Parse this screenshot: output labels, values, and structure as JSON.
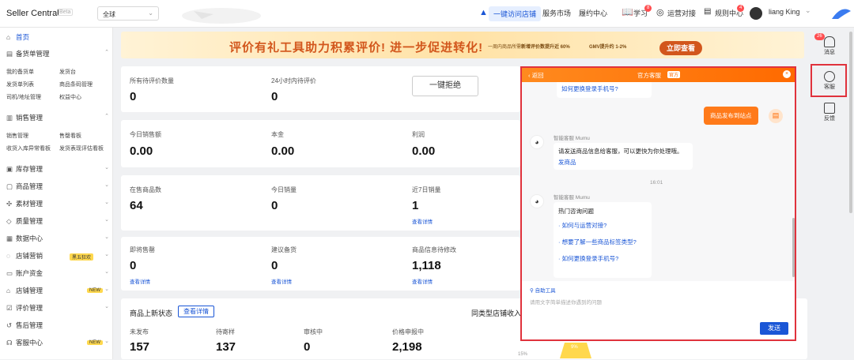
{
  "app": {
    "title": "Seller Central",
    "beta": "Beta",
    "region": "全球"
  },
  "topnav": {
    "promote": "一键访问店铺",
    "market": "服务市场",
    "fulfill": "履约中心",
    "learn": "学习",
    "learn_badge": "8",
    "ops": "运营对接",
    "rules": "规则中心",
    "rules_badge": "4",
    "user": "liang King"
  },
  "sidebar": {
    "home": "首页",
    "sections": [
      {
        "label": "备货单管理",
        "subs": [
          "我的备货单",
          "发货台",
          "发货单列表",
          "商品条码管理",
          "司机/地址管理",
          "权益中心"
        ]
      },
      {
        "label": "销售管理",
        "subs": [
          "销售管理",
          "售罄看板",
          "收货入库异常看板",
          "发货表现评估看板"
        ]
      }
    ],
    "items": [
      "库存管理",
      "商品管理",
      "素材管理",
      "质量管理",
      "数据中心",
      "店铺营销",
      "账户资金",
      "店铺管理",
      "评价管理",
      "售后管理",
      "客服中心"
    ],
    "tag_marketing": "黑五狂欢",
    "tag_new": "NEW"
  },
  "banner": {
    "title": "评价有礼工具助力积累评价! 进一步促进转化!",
    "note1": "一周内商品所需",
    "note2": "新增评价数提升近 60%",
    "note3": "GMV提升约 1-2%",
    "button": "立即查看"
  },
  "stats": {
    "pending_review_label": "所有待评价数量",
    "pending_review_value": "0",
    "pending_24h_label": "24小时内待评价",
    "pending_24h_value": "0",
    "reject_button": "一键拒绝",
    "today_sales_label": "今日销售额",
    "today_sales_value": "0.00",
    "cost_label": "本金",
    "cost_value": "0.00",
    "profit_label": "利润",
    "profit_value": "0.00",
    "on_sale_label": "在售商品数",
    "on_sale_value": "64",
    "today_units_label": "今日销量",
    "today_units_value": "0",
    "week_units_label": "近7日销量",
    "week_units_value": "1",
    "view_detail": "查看详情",
    "sellout_label": "即将售罄",
    "sellout_value": "0",
    "restock_label": "建议备货",
    "restock_value": "0",
    "info_fix_label": "商品信息待修改",
    "info_fix_value": "1,118"
  },
  "launch": {
    "title": "商品上新状态",
    "detail_button": "查看详情",
    "unpublished_label": "未发布",
    "unpublished_value": "157",
    "pending_label": "待寄样",
    "pending_value": "137",
    "review_label": "审核中",
    "review_value": "0",
    "price_label": "价格申报中",
    "price_value": "2,198",
    "compare_title": "同类型店铺收入",
    "compare_pct": "15%",
    "funnel_label": "9%"
  },
  "rail": {
    "msg": "消息",
    "msg_badge": "26",
    "cs": "客服",
    "feedback": "反馈"
  },
  "chat": {
    "back": "返回",
    "title": "官方客服",
    "official_tag": "官方",
    "prev_link": "如何更换登录手机号?",
    "user_msg": "商品发布到站点",
    "agent_name": "智能客服 Mumu",
    "agent_msg": "请发送商品信息给客服，可以更快为你处理哦。",
    "send_product": "发商品",
    "time": "16:01",
    "agent_name2": "智能客服 Mumu",
    "hot_title": "热门咨询问题",
    "q1": "如何与运营对接?",
    "q2": "想要了解一些商品标签类型?",
    "q3": "如何更换登录手机号?",
    "tool": "自助工具",
    "placeholder": "请用文字简单描述你遇到的问题",
    "send": "发送"
  }
}
